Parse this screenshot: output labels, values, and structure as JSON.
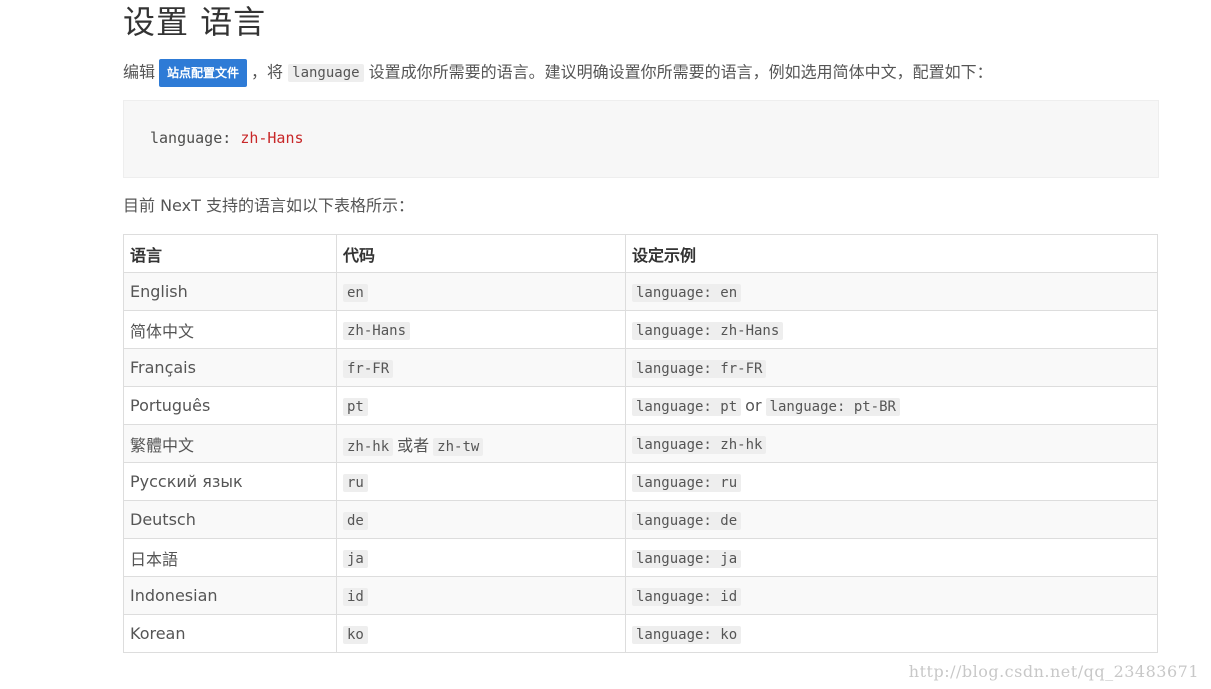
{
  "heading": "设置 语言",
  "intro": {
    "prefix": "编辑",
    "badge": "站点配置文件",
    "comma": "，将",
    "code": "language",
    "suffix": "设置成你所需要的语言。建议明确设置你所需要的语言，例如选用简体中文，配置如下："
  },
  "config_example": {
    "key": "language:",
    "value": "zh-Hans"
  },
  "table_intro": "目前 NexT 支持的语言如以下表格所示：",
  "table": {
    "headers": [
      "语言",
      "代码",
      "设定示例"
    ],
    "rows": [
      {
        "language": "English",
        "code": "en",
        "example": "language: en"
      },
      {
        "language": "简体中文",
        "code": "zh-Hans",
        "example": "language: zh-Hans"
      },
      {
        "language": "Français",
        "code": "fr-FR",
        "example": "language: fr-FR"
      },
      {
        "language": "Português",
        "code": "pt",
        "example": "language: pt",
        "connector": "or",
        "example_alt": "language: pt-BR"
      },
      {
        "language": "繁體中文",
        "code": "zh-hk",
        "code_connector": "或者",
        "code_alt": "zh-tw",
        "example": "language: zh-hk"
      },
      {
        "language": "Русский язык",
        "code": "ru",
        "example": "language: ru"
      },
      {
        "language": "Deutsch",
        "code": "de",
        "example": "language: de"
      },
      {
        "language": "日本語",
        "code": "ja",
        "example": "language: ja"
      },
      {
        "language": "Indonesian",
        "code": "id",
        "example": "language: id"
      },
      {
        "language": "Korean",
        "code": "ko",
        "example": "language: ko"
      }
    ]
  },
  "watermark": "http://blog.csdn.net/qq_23483671",
  "colors": {
    "badge": "#2e7bd6",
    "code_value": "#c82829",
    "code_bg": "#eeeeee",
    "codeblock_bg": "#f7f7f7"
  }
}
